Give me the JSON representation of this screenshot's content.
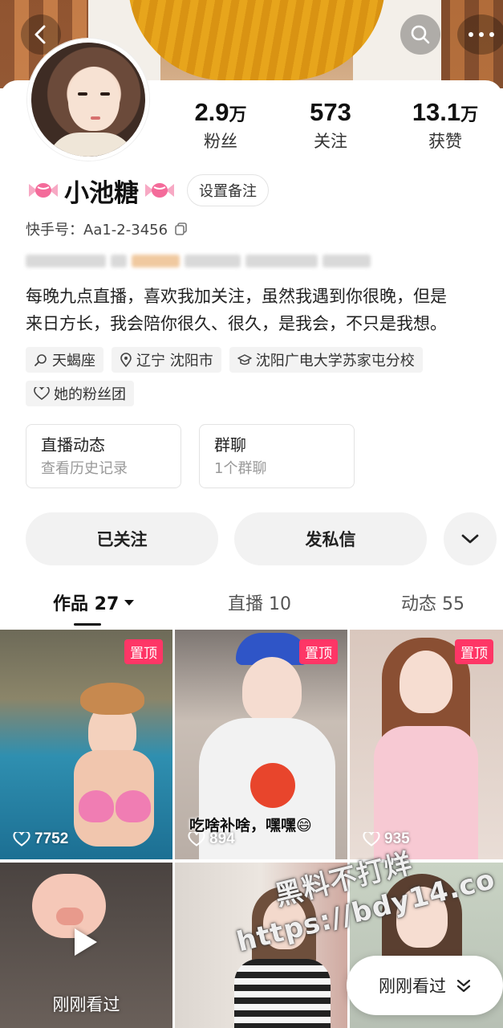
{
  "profile": {
    "name": "小池糖",
    "remark_button": "设置备注",
    "kuaishou_id": "快手号：Aa1-2-3456",
    "bio_line1": "每晚九点直播，喜欢我加关注，虽然我遇到你很晚，但是",
    "bio_line2": "来日方长，我会陪你很久、很久，是我会，不只是我想。"
  },
  "stats": [
    {
      "value": "2.9",
      "unit": "万",
      "label": "粉丝"
    },
    {
      "value": "573",
      "unit": "",
      "label": "关注"
    },
    {
      "value": "13.1",
      "unit": "万",
      "label": "获赞"
    }
  ],
  "tags": {
    "zodiac": "天蝎座",
    "location": "辽宁 沈阳市",
    "school": "沈阳广电大学苏家屯分校",
    "fan_group": "她的粉丝团"
  },
  "cards": {
    "live": {
      "title": "直播动态",
      "subtitle": "查看历史记录"
    },
    "group": {
      "title": "群聊",
      "subtitle": "1个群聊"
    }
  },
  "actions": {
    "followed": "已关注",
    "message": "发私信"
  },
  "tabs": {
    "works": "作品 27",
    "live": "直播 10",
    "moments": "动态 55"
  },
  "videos": [
    {
      "pinned": "置顶",
      "likes": "7752",
      "caption": ""
    },
    {
      "pinned": "置顶",
      "likes": "894",
      "caption": "吃啥补啥，嘿嘿😄"
    },
    {
      "pinned": "置顶",
      "likes": "935",
      "caption": ""
    },
    {
      "watched": "刚刚看过"
    }
  ],
  "watermark": {
    "line1": "黑料不打烊",
    "line2": "https://bdy14.co"
  },
  "recent_pill": "刚刚看过",
  "colors": {
    "accent_pin": "#fe3666",
    "button_bg": "#f2f2f2"
  },
  "icons": [
    "back-arrow-icon",
    "search-icon",
    "more-dots-icon",
    "copy-icon",
    "zodiac-icon",
    "location-icon",
    "school-icon",
    "heart-outline-icon",
    "chevron-down-icon",
    "caret-down-icon",
    "play-icon",
    "double-chevron-down-icon",
    "candy-icon"
  ]
}
